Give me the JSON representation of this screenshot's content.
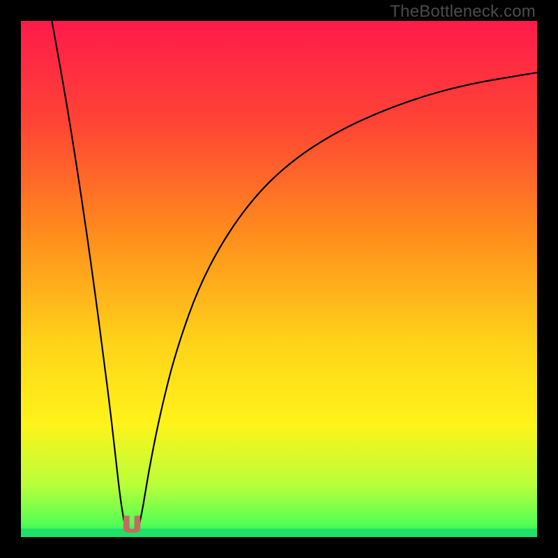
{
  "watermark": "TheBottleneck.com",
  "colors": {
    "bg_black": "#000000",
    "curve_stroke": "#000000",
    "marker_fill": "#c66a60",
    "marker_stroke": "#c66a60",
    "green_band": "#1fe06a"
  },
  "chart_data": {
    "type": "line",
    "title": "",
    "xlabel": "",
    "ylabel": "",
    "xlim": [
      0,
      100
    ],
    "ylim": [
      0,
      100
    ],
    "grid": false,
    "legend": false,
    "background_gradient": {
      "direction": "vertical",
      "stops": [
        {
          "pos": 0.0,
          "color": "#ff1a4b"
        },
        {
          "pos": 0.2,
          "color": "#ff4534"
        },
        {
          "pos": 0.42,
          "color": "#ff8f1c"
        },
        {
          "pos": 0.62,
          "color": "#ffd21a"
        },
        {
          "pos": 0.78,
          "color": "#fff31a"
        },
        {
          "pos": 0.9,
          "color": "#b8ff3a"
        },
        {
          "pos": 0.975,
          "color": "#54ff54"
        },
        {
          "pos": 1.0,
          "color": "#1fe06a"
        }
      ]
    },
    "series": [
      {
        "name": "left-branch",
        "x": [
          6,
          8,
          10,
          12,
          14,
          16,
          17.5,
          18.5,
          19.2,
          19.8,
          20.3
        ],
        "y": [
          100,
          89,
          77,
          64,
          50,
          35,
          23,
          14,
          8,
          4,
          1.5
        ]
      },
      {
        "name": "right-branch",
        "x": [
          22.7,
          23.3,
          24,
          25,
          27,
          30,
          35,
          42,
          50,
          60,
          72,
          85,
          100
        ],
        "y": [
          1.5,
          4,
          8,
          14,
          24,
          36,
          50,
          62,
          71,
          78,
          83.5,
          87.5,
          90
        ]
      }
    ],
    "marker": {
      "shape": "u-notch",
      "x_center": 21.5,
      "x_width": 3.0,
      "y_top": 4.0,
      "y_bottom": 1.0
    }
  }
}
